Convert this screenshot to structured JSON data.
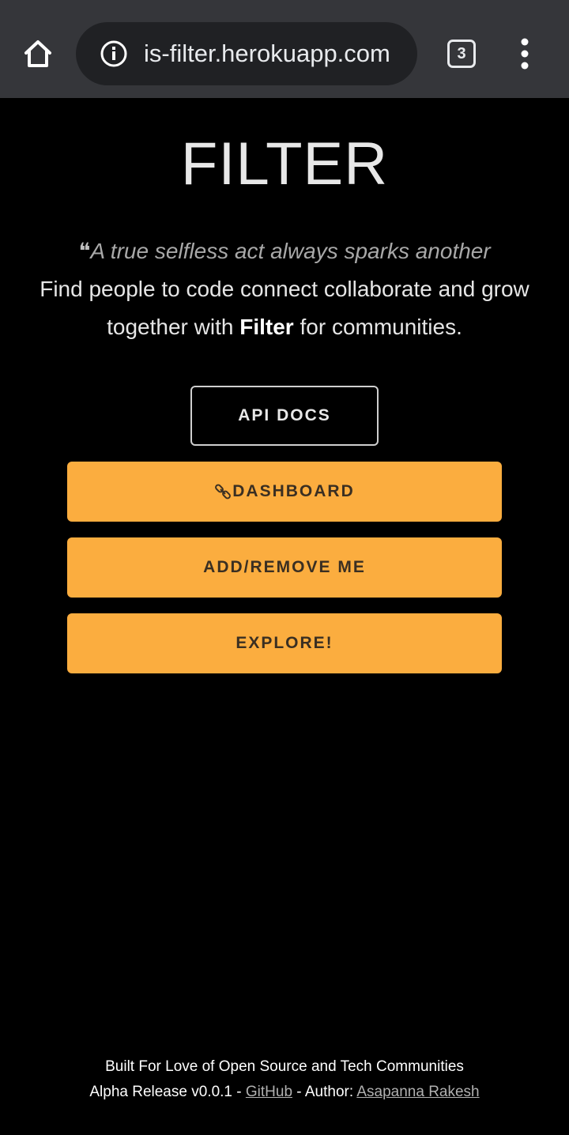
{
  "browser": {
    "url": "is-filter.herokuapp.com",
    "tab_count": "3",
    "icons": [
      "home-icon",
      "info-icon",
      "tabs-icon",
      "more-vert-icon"
    ]
  },
  "header": {
    "title": "FILTER"
  },
  "hero": {
    "quote_mark": "❝",
    "quote": "A true selfless act always sparks another",
    "tagline_before": "Find people to code connect collaborate and grow together with ",
    "tagline_brand": "Filter",
    "tagline_after": " for communities."
  },
  "actions": {
    "api_docs": "API DOCS",
    "dashboard": "DASHBOARD",
    "add_remove": "ADD/REMOVE ME",
    "explore": "EXPLORE!"
  },
  "footer": {
    "line1": "Built For Love of Open Source and Tech Communities",
    "release": "Alpha Release v0.0.1",
    "sep1": " - ",
    "github": "GitHub",
    "author_prefix": " - Author: ",
    "author": "Asapanna Rakesh"
  },
  "colors": {
    "accent": "#fbad3f",
    "background": "#000000",
    "browser_bar": "#35363a"
  }
}
